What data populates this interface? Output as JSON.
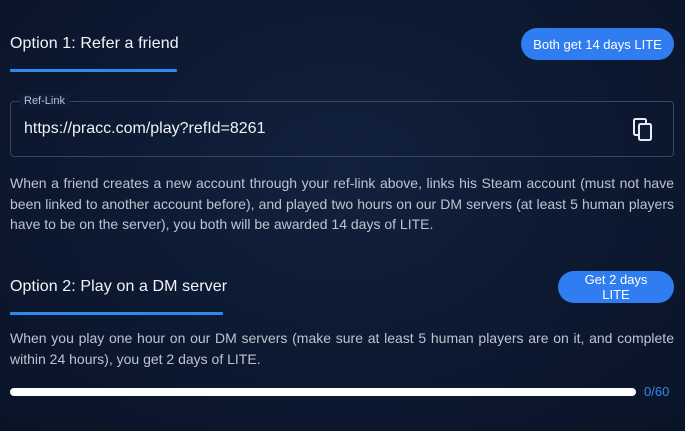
{
  "option1": {
    "title": "Option 1: Refer a friend",
    "reward_button": "Both get 14 days LITE",
    "reflink": {
      "label": "Ref-Link",
      "value": "https://pracc.com/play?refId=8261",
      "copy_icon": "copy-icon"
    },
    "description": "When a friend creates a new account through your ref-link above, links his Steam account (must not have been linked to another account before), and played two hours on our DM servers (at least 5 human players have to be on the server), you both will be awarded 14 days of LITE."
  },
  "option2": {
    "title": "Option 2: Play on a DM server",
    "reward_button": "Get 2 days LITE",
    "description": "When you play one hour on our DM servers (make sure at least 5 human players are on it, and complete within 24 hours), you get 2 days of LITE.",
    "progress": {
      "value": 0,
      "max": 60,
      "text": "0/60"
    }
  },
  "colors": {
    "accent": "#2f7df0",
    "background": "#0d1a33",
    "text_muted": "#bdc4d1"
  }
}
